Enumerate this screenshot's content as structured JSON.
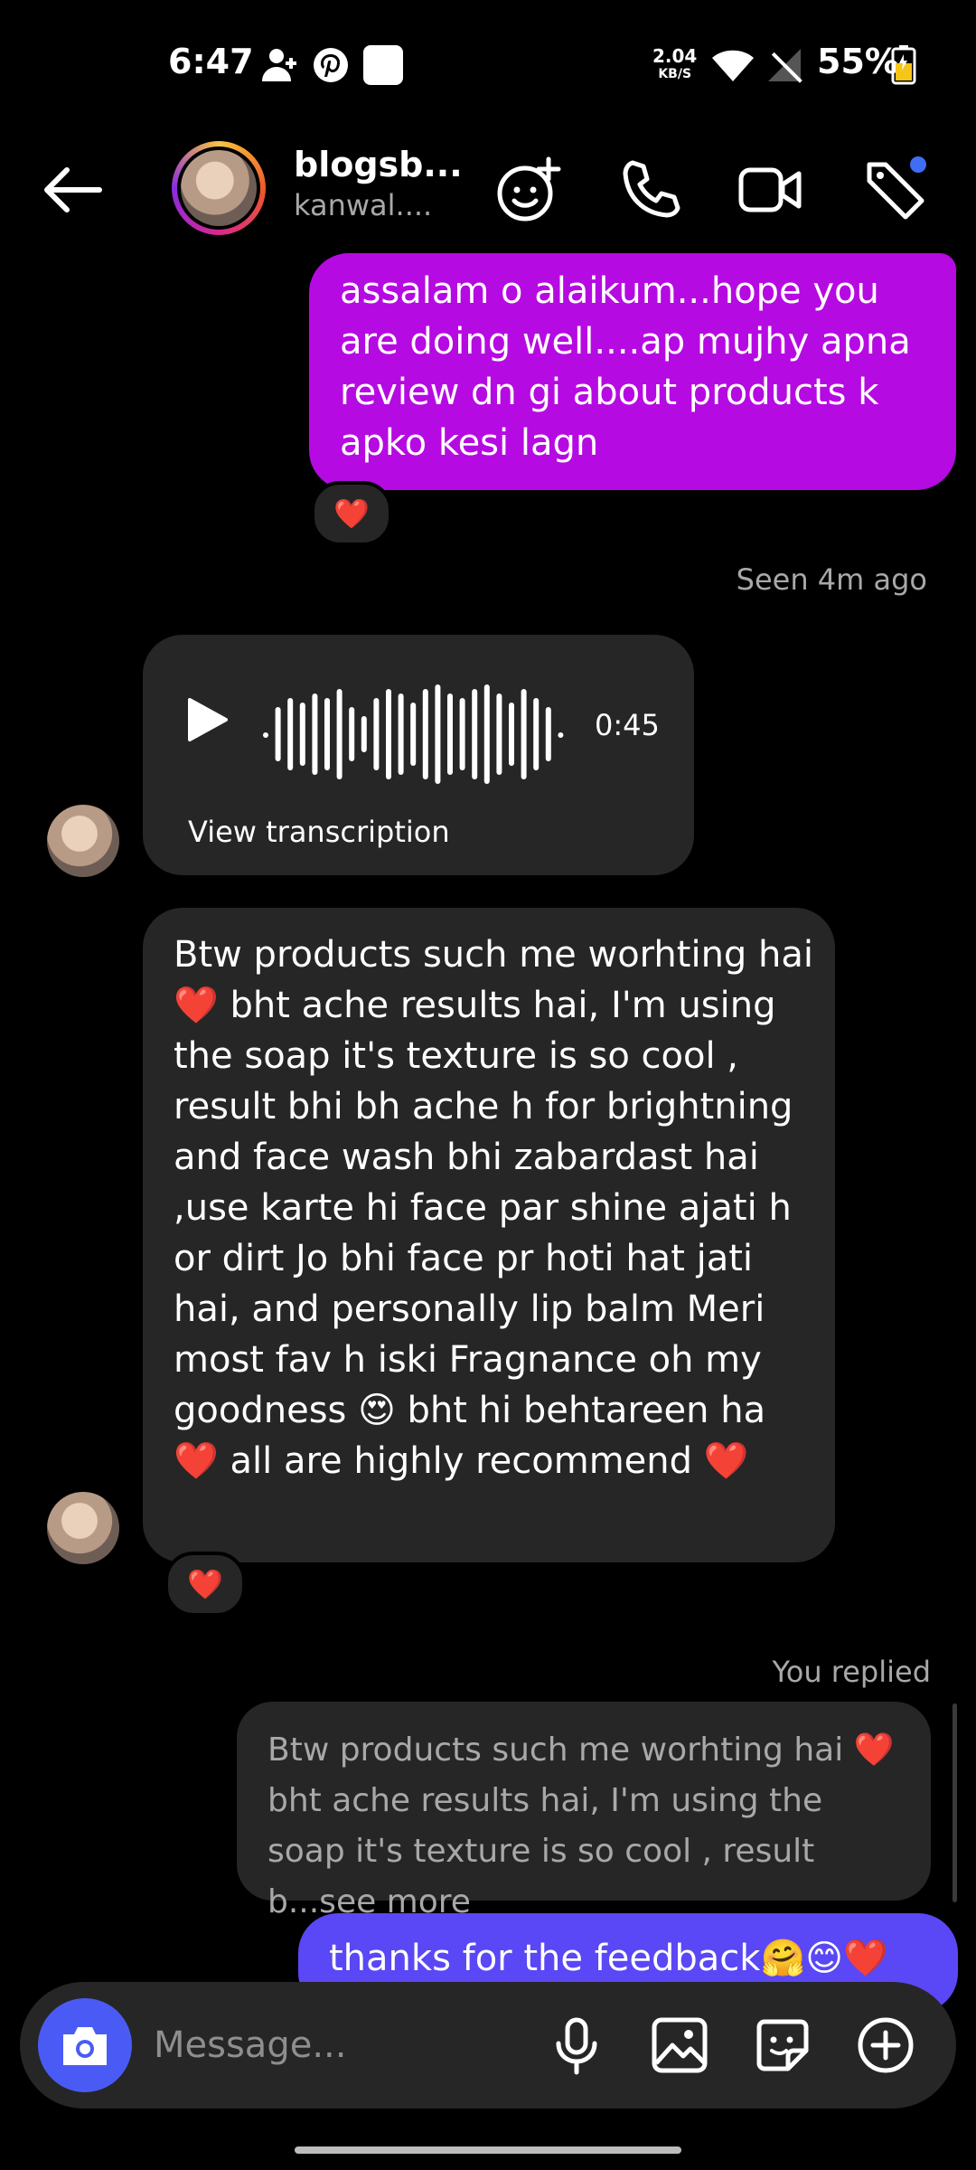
{
  "status_bar": {
    "time": "6:47",
    "net_speed_value": "2.04",
    "net_speed_unit": "KB/S",
    "battery_pct": "55%"
  },
  "header": {
    "name": "blogsb...",
    "username": "kanwal...."
  },
  "messages": {
    "first_out": "assalam o alaikum...hope you are doing well....ap mujhy apna review dn gi about products k apko kesi lagn",
    "first_reaction": "❤️",
    "seen": "Seen 4m ago",
    "voice_duration": "0:45",
    "voice_transcription": "View transcription",
    "long_in": "Btw products such me worhting hai ❤️ bht ache results hai, I'm using the soap it's texture is so cool , result bhi bh ache h for brightning and face wash bhi zabardast hai ,use karte hi face par shine ajati h or dirt Jo bhi face pr hoti hat jati hai, and personally lip balm Meri most fav h iski Fragnance oh my goodness 😍 bht hi behtareen ha ❤️ all are highly recommend ❤️",
    "long_reaction": "❤️",
    "replied_label": "You replied",
    "quoted": "Btw products such me worhting hai ❤️ bht ache results hai, I'm using the soap it's texture is so cool , result b...see more",
    "last_out": "thanks for the feedback🤗😊❤️"
  },
  "composer": {
    "placeholder": "Message..."
  },
  "colors": {
    "outgoing_purple": "#b60ae2",
    "outgoing_blue": "#5a47f5",
    "incoming_bg": "#262626",
    "camera_button": "#4a5bf5"
  }
}
